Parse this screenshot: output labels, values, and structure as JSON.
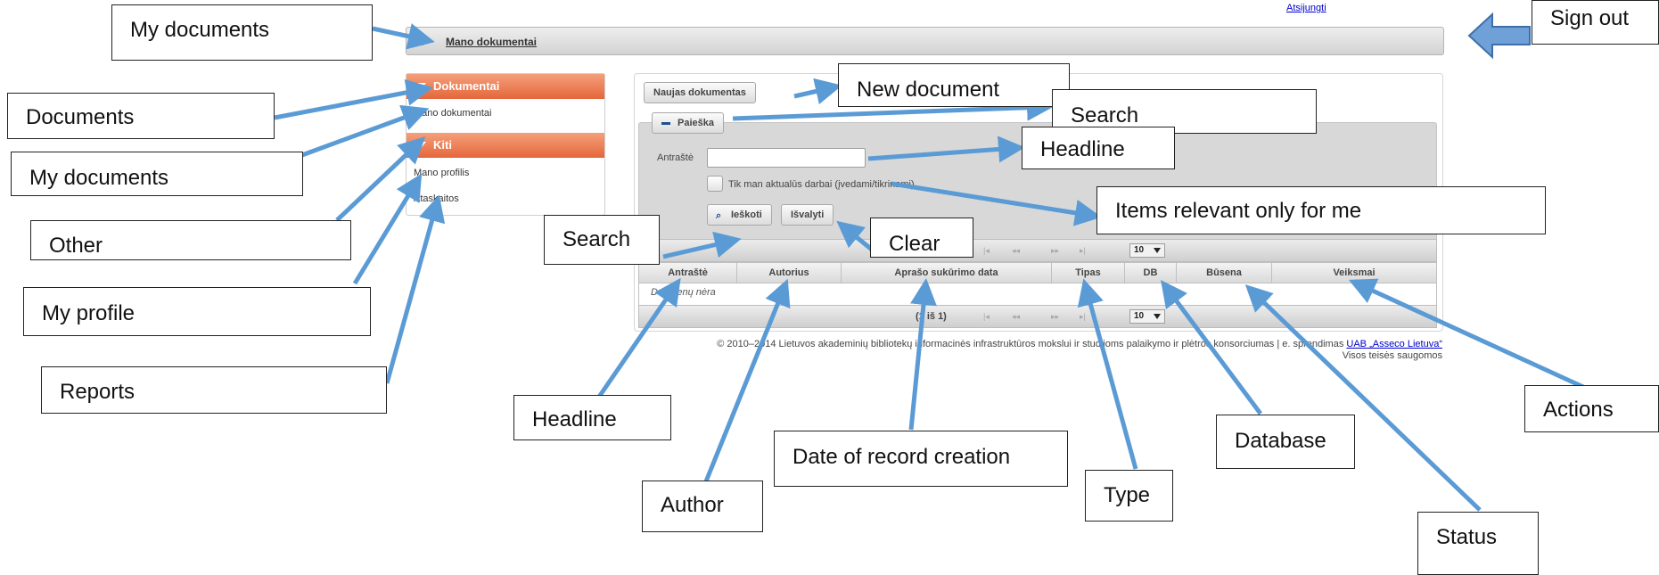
{
  "app": {
    "signout": "Atsijungti",
    "breadcrumb": {
      "home_icon": "home-icon",
      "current": "Mano dokumentai"
    },
    "sidebar": {
      "sections": [
        {
          "title": "Dokumentai",
          "items": [
            "Mano dokumentai"
          ]
        },
        {
          "title": "Kiti",
          "items": [
            "Mano profilis",
            "Ataskaitos"
          ]
        }
      ]
    },
    "new_document_button": "Naujas dokumentas",
    "search_toggle": "Paieška",
    "search_form": {
      "headline_label": "Antraštė",
      "headline_value": "",
      "relevant_checkbox_label": "Tik man aktualūs darbai (įvedami/tikrinami)",
      "search_button": "Ieškoti",
      "clear_button": "Išvalyti"
    },
    "pager": {
      "info": "(1 iš 1)",
      "page_size": "10"
    },
    "table": {
      "columns": [
        "Antraštė",
        "Autorius",
        "Aprašo sukūrimo data",
        "Tipas",
        "DB",
        "Būsena",
        "Veiksmai"
      ],
      "empty_message": "Duomenų nėra"
    },
    "footer": {
      "copyright": "© 2010–2014 Lietuvos akademinių bibliotekų informacinės infrastruktūros mokslui ir studijoms palaikymo ir plėtros konsorciumas | e. sprendimas",
      "link": "UAB „Asseco Lietuva“",
      "rights": "Visos teisės saugomos"
    }
  },
  "annotations": {
    "my_documents_top": "My documents",
    "sign_out": "Sign out",
    "documents": "Documents",
    "my_documents_side": "My documents",
    "other": "Other",
    "my_profile": "My profile",
    "reports": "Reports",
    "new_document": "New document",
    "search_toggle": "Search",
    "headline_field": "Headline",
    "relevant_items": "Items relevant only for me",
    "search_button": "Search",
    "clear_button": "Clear",
    "headline_col": "Headline",
    "author_col": "Author",
    "date_col": "Date of record creation",
    "type_col": "Type",
    "database_col": "Database",
    "status_col": "Status",
    "actions_col": "Actions"
  },
  "colors": {
    "accent": "#e5663b",
    "arrow": "#5b9bd5",
    "link": "#0000cc"
  }
}
